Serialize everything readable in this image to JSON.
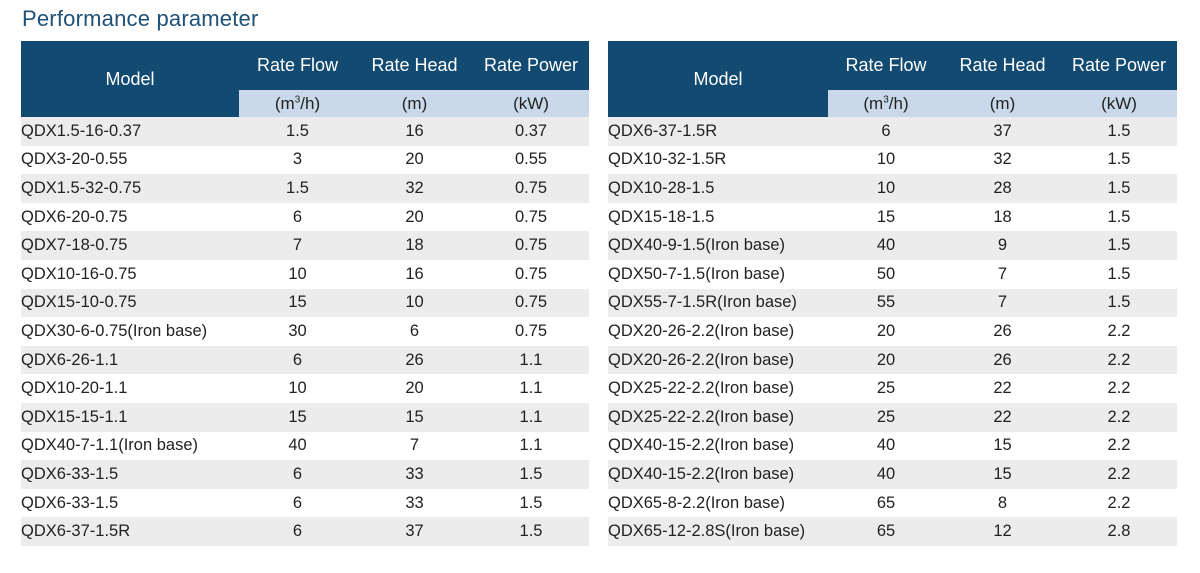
{
  "title": "Performance parameter",
  "columns": {
    "model": "Model",
    "flow": "Rate Flow",
    "head": "Rate Head",
    "power": "Rate Power"
  },
  "units": {
    "flow_base": "(m",
    "flow_exp": "3",
    "flow_tail": "/h)",
    "head": "(m)",
    "power": "(kW)"
  },
  "left_rows": [
    [
      "QDX1.5-16-0.37",
      "1.5",
      "16",
      "0.37"
    ],
    [
      "QDX3-20-0.55",
      "3",
      "20",
      "0.55"
    ],
    [
      "QDX1.5-32-0.75",
      "1.5",
      "32",
      "0.75"
    ],
    [
      "QDX6-20-0.75",
      "6",
      "20",
      "0.75"
    ],
    [
      "QDX7-18-0.75",
      "7",
      "18",
      "0.75"
    ],
    [
      "QDX10-16-0.75",
      "10",
      "16",
      "0.75"
    ],
    [
      "QDX15-10-0.75",
      "15",
      "10",
      "0.75"
    ],
    [
      "QDX30-6-0.75(Iron base)",
      "30",
      "6",
      "0.75"
    ],
    [
      "QDX6-26-1.1",
      "6",
      "26",
      "1.1"
    ],
    [
      "QDX10-20-1.1",
      "10",
      "20",
      "1.1"
    ],
    [
      "QDX15-15-1.1",
      "15",
      "15",
      "1.1"
    ],
    [
      "QDX40-7-1.1(Iron base)",
      "40",
      "7",
      "1.1"
    ],
    [
      "QDX6-33-1.5",
      "6",
      "33",
      "1.5"
    ],
    [
      "QDX6-33-1.5",
      "6",
      "33",
      "1.5"
    ],
    [
      "QDX6-37-1.5R",
      "6",
      "37",
      "1.5"
    ]
  ],
  "right_rows": [
    [
      "QDX6-37-1.5R",
      "6",
      "37",
      "1.5"
    ],
    [
      "QDX10-32-1.5R",
      "10",
      "32",
      "1.5"
    ],
    [
      "QDX10-28-1.5",
      "10",
      "28",
      "1.5"
    ],
    [
      "QDX15-18-1.5",
      "15",
      "18",
      "1.5"
    ],
    [
      "QDX40-9-1.5(Iron base)",
      "40",
      "9",
      "1.5"
    ],
    [
      "QDX50-7-1.5(Iron base)",
      "50",
      "7",
      "1.5"
    ],
    [
      "QDX55-7-1.5R(Iron base)",
      "55",
      "7",
      "1.5"
    ],
    [
      "QDX20-26-2.2(Iron base)",
      "20",
      "26",
      "2.2"
    ],
    [
      "QDX20-26-2.2(Iron base)",
      "20",
      "26",
      "2.2"
    ],
    [
      "QDX25-22-2.2(Iron base)",
      "25",
      "22",
      "2.2"
    ],
    [
      "QDX25-22-2.2(Iron base)",
      "25",
      "22",
      "2.2"
    ],
    [
      "QDX40-15-2.2(Iron base)",
      "40",
      "15",
      "2.2"
    ],
    [
      "QDX40-15-2.2(Iron base)",
      "40",
      "15",
      "2.2"
    ],
    [
      "QDX65-8-2.2(Iron base)",
      "65",
      "8",
      "2.2"
    ],
    [
      "QDX65-12-2.8S(Iron base)",
      "65",
      "12",
      "2.8"
    ]
  ],
  "colors": {
    "header_bg": "#124a72",
    "unit_bg": "#c9d9e9",
    "row_stripe": "#ececec",
    "title": "#1f5178"
  }
}
